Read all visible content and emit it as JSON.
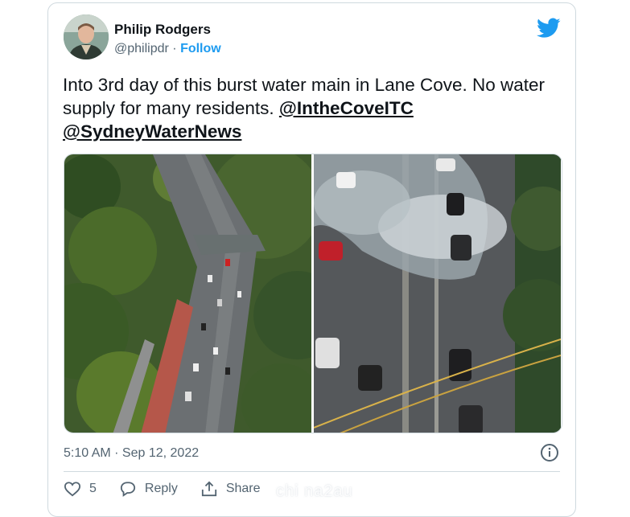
{
  "author": {
    "name": "Philip Rodgers",
    "handle": "@philipdr",
    "separator": "·",
    "follow_label": "Follow",
    "avatar_icon": "profile-photo"
  },
  "brand": {
    "icon": "twitter-bird-icon",
    "color": "#1d9bf0"
  },
  "tweet": {
    "text": "Into 3rd day of this burst water main in Lane Cove. No water supply for many residents.",
    "mentions": [
      "@IntheCoveITC",
      "@SydneyWaterNews"
    ]
  },
  "media": [
    {
      "icon": "photo-aerial-road-traffic"
    },
    {
      "icon": "photo-burst-water-main-road"
    }
  ],
  "meta": {
    "timestamp": "5:10 AM · Sep 12, 2022",
    "info_icon": "info-icon"
  },
  "actions": {
    "like_count": "5",
    "reply_label": "Reply",
    "share_label": "Share"
  },
  "watermark": "chi na2au"
}
